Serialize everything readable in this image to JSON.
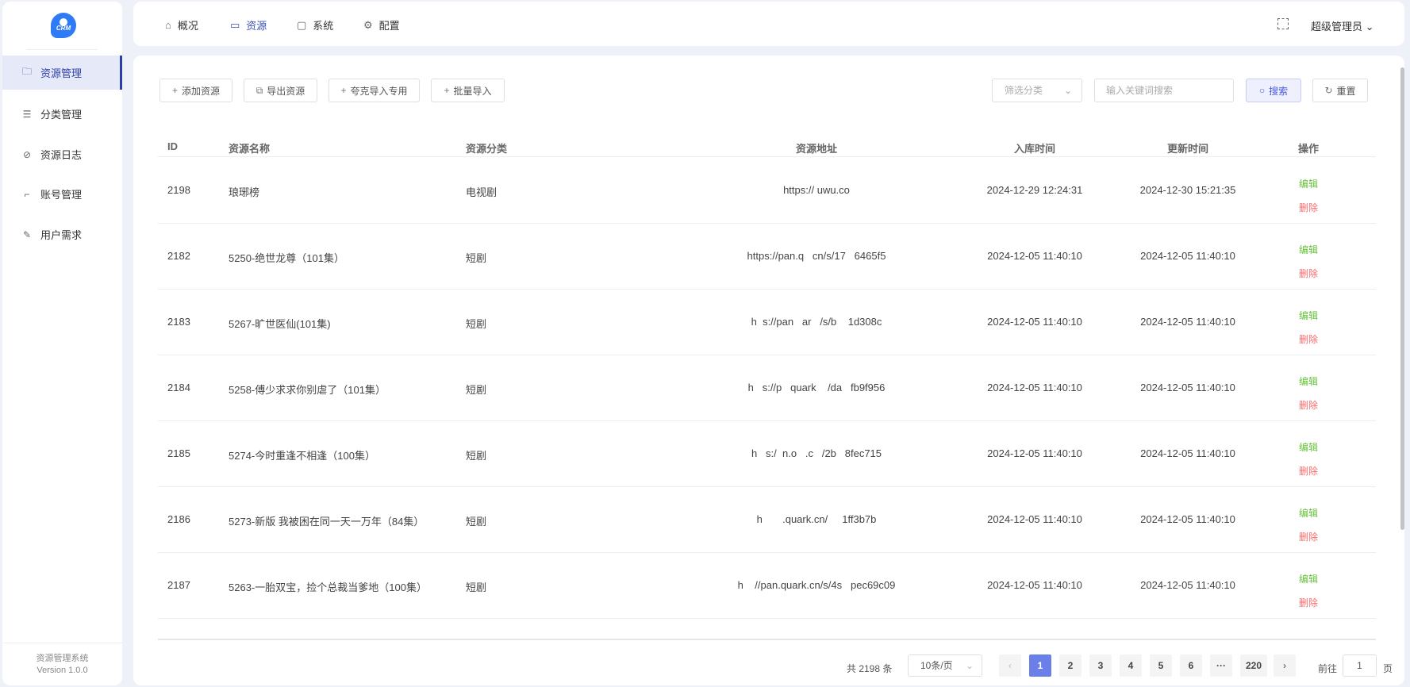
{
  "sidebar": {
    "logo_text": "CRM",
    "items": [
      {
        "label": "资源管理",
        "icon": "folder-icon",
        "active": true
      },
      {
        "label": "分类管理",
        "icon": "sliders-icon"
      },
      {
        "label": "资源日志",
        "icon": "compass-icon"
      },
      {
        "label": "账号管理",
        "icon": "crop-icon"
      },
      {
        "label": "用户需求",
        "icon": "pen-icon"
      }
    ],
    "footer_title": "资源管理系统",
    "footer_version": "Version 1.0.0"
  },
  "topbar": {
    "nav": [
      {
        "label": "概况",
        "icon": "home-icon"
      },
      {
        "label": "资源",
        "icon": "box-icon",
        "active": true
      },
      {
        "label": "系统",
        "icon": "monitor-icon"
      },
      {
        "label": "配置",
        "icon": "gear-icon"
      }
    ],
    "user": "超级管理员"
  },
  "toolbar": {
    "add": "添加资源",
    "export": "导出资源",
    "quark_import": "夸克导入专用",
    "batch_import": "批量导入",
    "filter_placeholder": "筛选分类",
    "search_placeholder": "输入关键词搜索",
    "search": "搜索",
    "reset": "重置"
  },
  "table": {
    "headers": {
      "id": "ID",
      "name": "资源名称",
      "category": "资源分类",
      "url": "资源地址",
      "created": "入库时间",
      "updated": "更新时间",
      "actions": "操作"
    },
    "edit": "编辑",
    "delete": "删除",
    "rows": [
      {
        "id": "2198",
        "name": "琅琊榜",
        "category": "电视剧",
        "url": "https:// uwu.co",
        "created": "2024-12-29 12:24:31",
        "updated": "2024-12-30 15:21:35"
      },
      {
        "id": "2182",
        "name": "5250-绝世龙尊（101集）",
        "category": "短剧",
        "url": "https://pan.q   cn/s/17   6465f5",
        "created": "2024-12-05 11:40:10",
        "updated": "2024-12-05 11:40:10"
      },
      {
        "id": "2183",
        "name": "5267-旷世医仙(101集)",
        "category": "短剧",
        "url": "h  s://pan   ar   /s/b    1d308c",
        "created": "2024-12-05 11:40:10",
        "updated": "2024-12-05 11:40:10"
      },
      {
        "id": "2184",
        "name": "5258-傅少求求你别虐了（101集）",
        "category": "短剧",
        "url": "h   s://p   quark    /da   fb9f956",
        "created": "2024-12-05 11:40:10",
        "updated": "2024-12-05 11:40:10"
      },
      {
        "id": "2185",
        "name": "5274-今时重逢不相逢（100集）",
        "category": "短剧",
        "url": "h   s:/  n.o   .c   /2b   8fec715",
        "created": "2024-12-05 11:40:10",
        "updated": "2024-12-05 11:40:10"
      },
      {
        "id": "2186",
        "name": "5273-新版 我被困在同一天一万年（84集）",
        "category": "短剧",
        "url": "h       .quark.cn/     1ff3b7b",
        "created": "2024-12-05 11:40:10",
        "updated": "2024-12-05 11:40:10"
      },
      {
        "id": "2187",
        "name": "5263-一胎双宝，捡个总裁当爹地（100集）",
        "category": "短剧",
        "url": "h    //pan.quark.cn/s/4s   pec69c09",
        "created": "2024-12-05 11:40:10",
        "updated": "2024-12-05 11:40:10"
      }
    ]
  },
  "pagination": {
    "total": "共 2198 条",
    "page_size": "10条/页",
    "pages": [
      "1",
      "2",
      "3",
      "4",
      "5",
      "6",
      "···",
      "220"
    ],
    "current": "1",
    "goto_label": "前往",
    "goto_value": "1",
    "page_suffix": "页",
    "prev": "‹",
    "next": "›"
  }
}
